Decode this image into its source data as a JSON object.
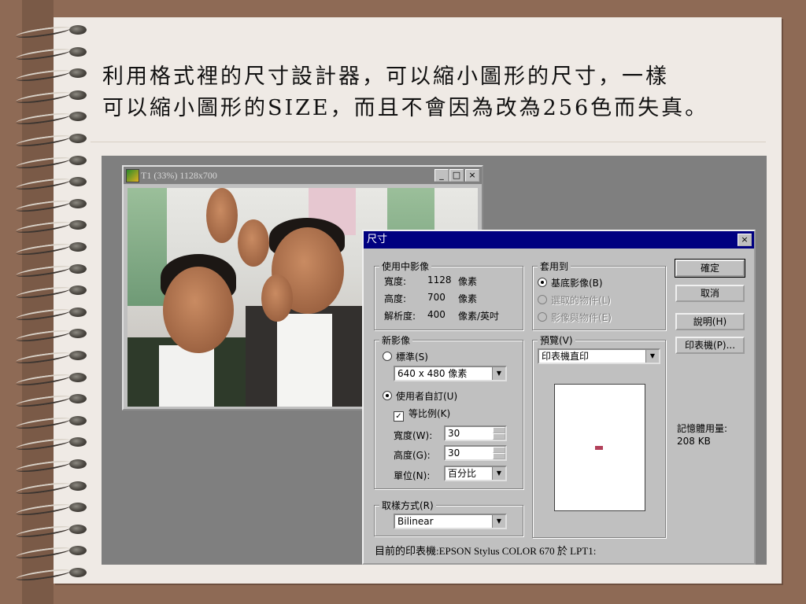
{
  "heading": {
    "line1": "利用格式裡的尺寸設計器，可以縮小圖形的尺寸，一樣",
    "line2": "可以縮小圖形的SIZE，而且不會因為改為256色而失真。"
  },
  "image_window": {
    "title": "T1 (33%) 1128x700",
    "minimize": "_",
    "maximize": "□",
    "close": "×"
  },
  "dialog": {
    "title": "尺寸",
    "close": "×",
    "current": {
      "legend": "使用中影像",
      "width_label": "寬度:",
      "width_value": "1128",
      "width_unit": "像素",
      "height_label": "高度:",
      "height_value": "700",
      "height_unit": "像素",
      "res_label": "解析度:",
      "res_value": "400",
      "res_unit": "像素/英吋"
    },
    "apply_to": {
      "legend": "套用到",
      "opt1": "基底影像(B)",
      "opt2": "選取的物件(L)",
      "opt3": "影像與物件(E)"
    },
    "new_image": {
      "legend": "新影像",
      "standard": "標準(S)",
      "standard_value": "640 x 480 像素",
      "custom": "使用者自訂(U)",
      "ratio": "等比例(K)",
      "width_label": "寬度(W):",
      "width_value": "30",
      "height_label": "高度(G):",
      "height_value": "30",
      "unit_label": "單位(N):",
      "unit_value": "百分比"
    },
    "preview": {
      "legend": "預覽(V)",
      "select_value": "印表機直印"
    },
    "sampling": {
      "legend": "取樣方式(R)",
      "value": "Bilinear"
    },
    "buttons": {
      "ok": "確定",
      "cancel": "取消",
      "help": "說明(H)",
      "printer": "印表機(P)..."
    },
    "memory": {
      "label": "記憶體用量:",
      "value": "208 KB"
    },
    "status": "目前的印表機:EPSON Stylus COLOR 670 於 LPT1:"
  }
}
